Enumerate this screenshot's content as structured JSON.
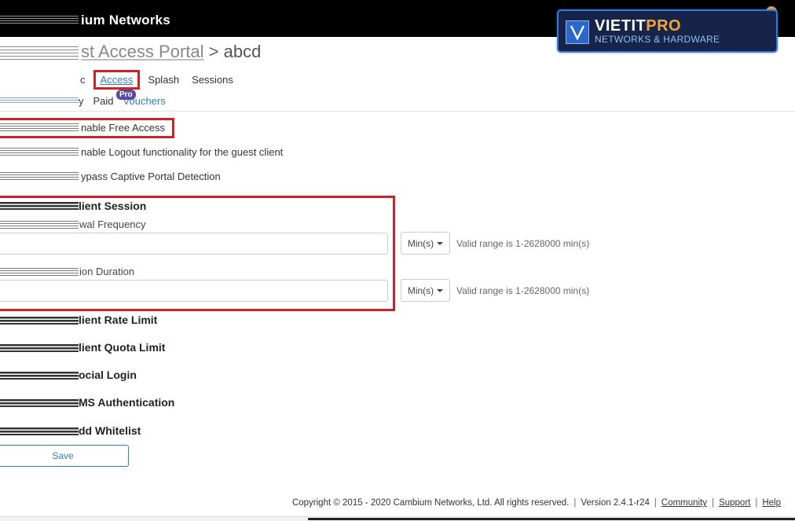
{
  "header": {
    "brand": "ium Networks"
  },
  "logo": {
    "main": "VIETIT",
    "accent": "PRO",
    "sub": "NETWORKS & HARDWARE",
    "icon": "v-logo-icon"
  },
  "title": {
    "crumb": "st Access Portal",
    "separator": ">",
    "name": "abcd"
  },
  "tabs": [
    {
      "label": "c"
    },
    {
      "label": "Access"
    },
    {
      "label": "Splash"
    },
    {
      "label": "Sessions"
    }
  ],
  "subtabs": [
    {
      "label": "y"
    },
    {
      "label": "Paid"
    },
    {
      "label": "Vouchers"
    }
  ],
  "badge": {
    "pro": "Pro"
  },
  "options": {
    "free_access": "nable Free Access",
    "logout": "nable Logout functionality for the guest client",
    "bypass": "ypass Captive Portal Detection"
  },
  "client_session": {
    "title": "lient Session",
    "renewal_label": "wal Frequency",
    "renewal_value": "",
    "renewal_unit": "Min(s)",
    "renewal_hint": "Valid range is 1-2628000 min(s)",
    "duration_label": "ion Duration",
    "duration_value": "",
    "duration_unit": "Min(s)",
    "duration_hint": "Valid range is 1-2628000 min(s)"
  },
  "sections": {
    "rate_limit": "lient Rate Limit",
    "quota_limit": "lient Quota Limit",
    "social_login": "ocial Login",
    "sms_auth": "MS Authentication",
    "whitelist": "dd Whitelist"
  },
  "actions": {
    "save": "Save"
  },
  "footer": {
    "copyright": "Copyright © 2015 - 2020 Cambium Networks, Ltd. All rights reserved.",
    "version": "Version 2.4.1-r24",
    "community": "Community",
    "support": "Support",
    "help": "Help",
    "separator": "|"
  },
  "colors": {
    "accent_red": "#cc2229",
    "link_blue": "#2f7fb5",
    "topbar": "#000000",
    "logo_bg": "#17244a",
    "logo_orange": "#f2a63a"
  }
}
